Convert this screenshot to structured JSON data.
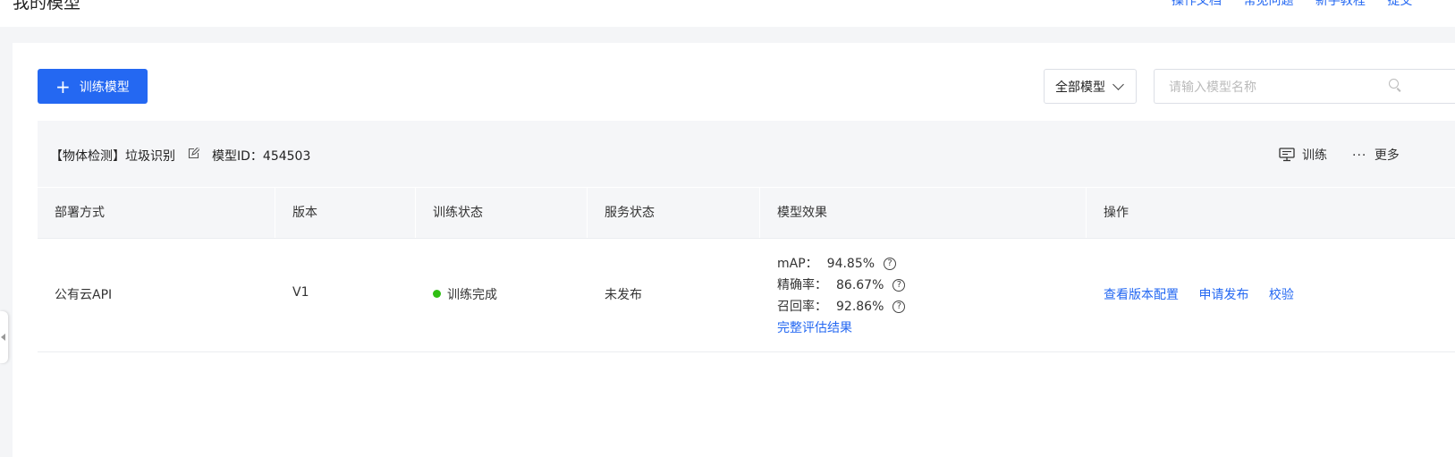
{
  "page": {
    "title": "我的模型"
  },
  "top_links": [
    "操作文档",
    "常见问题",
    "新手教程",
    "提交"
  ],
  "toolbar": {
    "train_button": "训练模型",
    "filter_value": "全部模型",
    "search_placeholder": "请输入模型名称"
  },
  "model": {
    "name": "【物体检测】垃圾识别",
    "id_label": "模型ID：",
    "id_value": "454503",
    "actions": {
      "train": "训练",
      "more": "更多"
    }
  },
  "table": {
    "columns": [
      "部署方式",
      "版本",
      "训练状态",
      "服务状态",
      "模型效果",
      "操作"
    ],
    "rows": [
      {
        "deploy": "公有云API",
        "version": "V1",
        "train_status": "训练完成",
        "train_status_color": "#30bf13",
        "service_status": "未发布",
        "metrics": [
          {
            "label": "mAP：",
            "value": "94.85%"
          },
          {
            "label": "精确率：",
            "value": "86.67%"
          },
          {
            "label": "召回率：",
            "value": "92.86%"
          }
        ],
        "full_eval_link": "完整评估结果",
        "operations": [
          "查看版本配置",
          "申请发布",
          "校验"
        ]
      }
    ]
  },
  "colors": {
    "primary": "#2468f2",
    "success": "#30bf13"
  }
}
